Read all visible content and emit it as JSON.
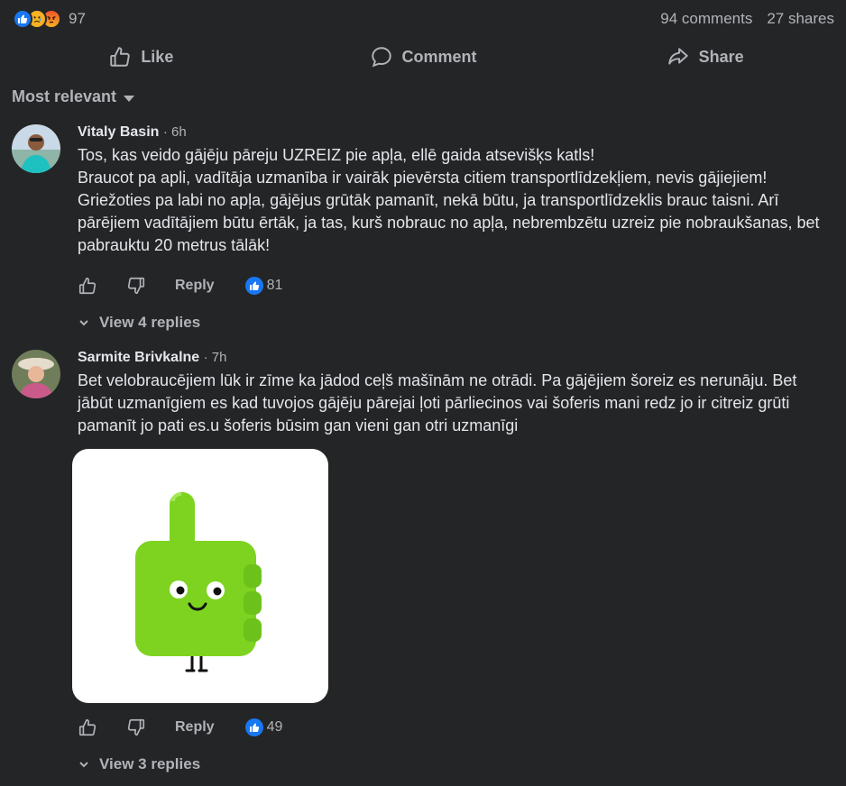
{
  "post": {
    "reaction_icons": [
      "like-icon",
      "sad-icon",
      "angry-icon"
    ],
    "reaction_count": "97",
    "comments_label": "94 comments",
    "shares_label": "27 shares"
  },
  "actions": {
    "like": "Like",
    "comment": "Comment",
    "share": "Share"
  },
  "filter": {
    "label": "Most relevant"
  },
  "comments": [
    {
      "author": "Vitaly Basin",
      "time": "· 6h",
      "text": "Tos, kas veido gājēju pāreju UZREIZ pie apļa, ellē gaida atsevišķs katls!\nBraucot pa apli, vadītāja uzmanība ir vairāk pievērsta citiem transportlīdzekļiem, nevis gājiejiem! Griežoties pa labi no apļa, gājējus grūtāk pamanīt, nekā būtu, ja transportlīdzeklis brauc taisni. Arī pārējiem vadītājiem būtu ērtāk, ja tas, kurš nobrauc no apļa, nebrembzētu uzreiz pie nobraukšanas, bet pabrauktu 20 metrus tālāk!",
      "reply_label": "Reply",
      "likes": "81",
      "view_replies": "View 4 replies"
    },
    {
      "author": "Sarmite Brivkalne",
      "time": "· 7h",
      "text": "Bet velobraucējiem lūk ir zīme ka jādod ceļš mašīnām ne otrādi. Pa gājējiem šoreiz es nerunāju. Bet jābūt uzmanīgiem es kad tuvojos gājēju pārejai ļoti pārliecinos vai šoferis mani redz jo ir citreiz grūti pamanīt jo pati es.u šoferis būsim gan vieni gan otri uzmanīgi",
      "reply_label": "Reply",
      "likes": "49",
      "view_replies": "View 3 replies",
      "sticker": "thumbs-up-sticker"
    }
  ],
  "colors": {
    "background": "#242526",
    "text_primary": "#e4e6eb",
    "text_secondary": "#b0b3b8",
    "like_blue": "#1877f2",
    "sticker_green": "#7ed321"
  }
}
